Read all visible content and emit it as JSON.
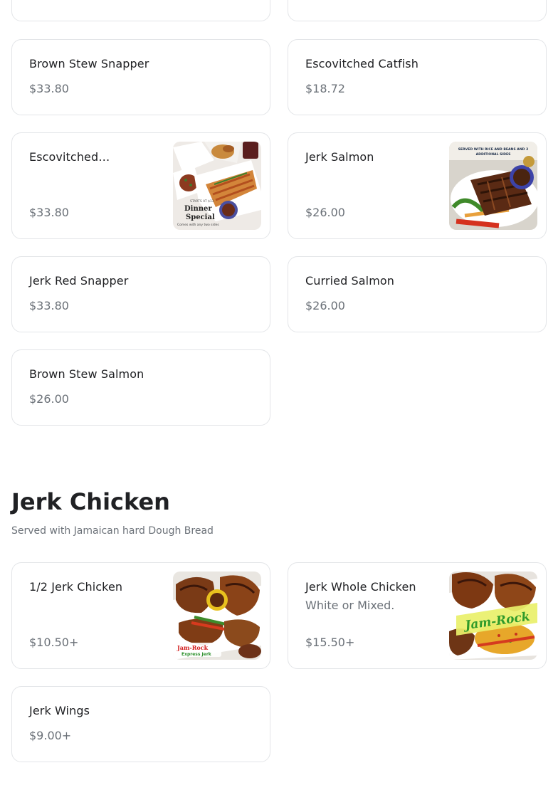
{
  "fish_section": {
    "items": [
      {
        "name": "Brown Stew Snapper",
        "price": "$33.80"
      },
      {
        "name": "Escovitched Catfish",
        "price": "$18.72"
      },
      {
        "name": "Escovitched…",
        "price": "$33.80",
        "image": "dinner-special-photo",
        "image_text": {
          "small": "STARTS AT $13",
          "title_1": "Dinner",
          "title_2": "Special",
          "caption": "Comes with any two sides"
        }
      },
      {
        "name": "Jerk Salmon",
        "price": "$26.00",
        "image": "jerk-salmon-photo",
        "image_text": {
          "banner_1": "SERVED WITH RICE AND BEANS AND 2",
          "banner_2": "ADDITIONAL SIDES"
        }
      },
      {
        "name": "Jerk Red Snapper",
        "price": "$33.80"
      },
      {
        "name": "Curried Salmon",
        "price": "$26.00"
      },
      {
        "name": "Brown Stew Salmon",
        "price": "$26.00"
      }
    ]
  },
  "jerk_chicken_section": {
    "title": "Jerk Chicken",
    "subtitle": "Served with Jamaican hard Dough Bread",
    "items": [
      {
        "name": "1/2 Jerk Chicken",
        "price": "$10.50+",
        "image": "half-jerk-chicken-photo",
        "image_text": {
          "logo_1": "Jam-Rock",
          "logo_2": "Express Jerk"
        }
      },
      {
        "name": "Jerk Whole Chicken",
        "description": "White or Mixed.",
        "price": "$15.50+",
        "image": "whole-jerk-chicken-photo",
        "image_text": {
          "logo": "Jam-Rock"
        }
      },
      {
        "name": "Jerk Wings",
        "price": "$9.00+"
      }
    ]
  }
}
